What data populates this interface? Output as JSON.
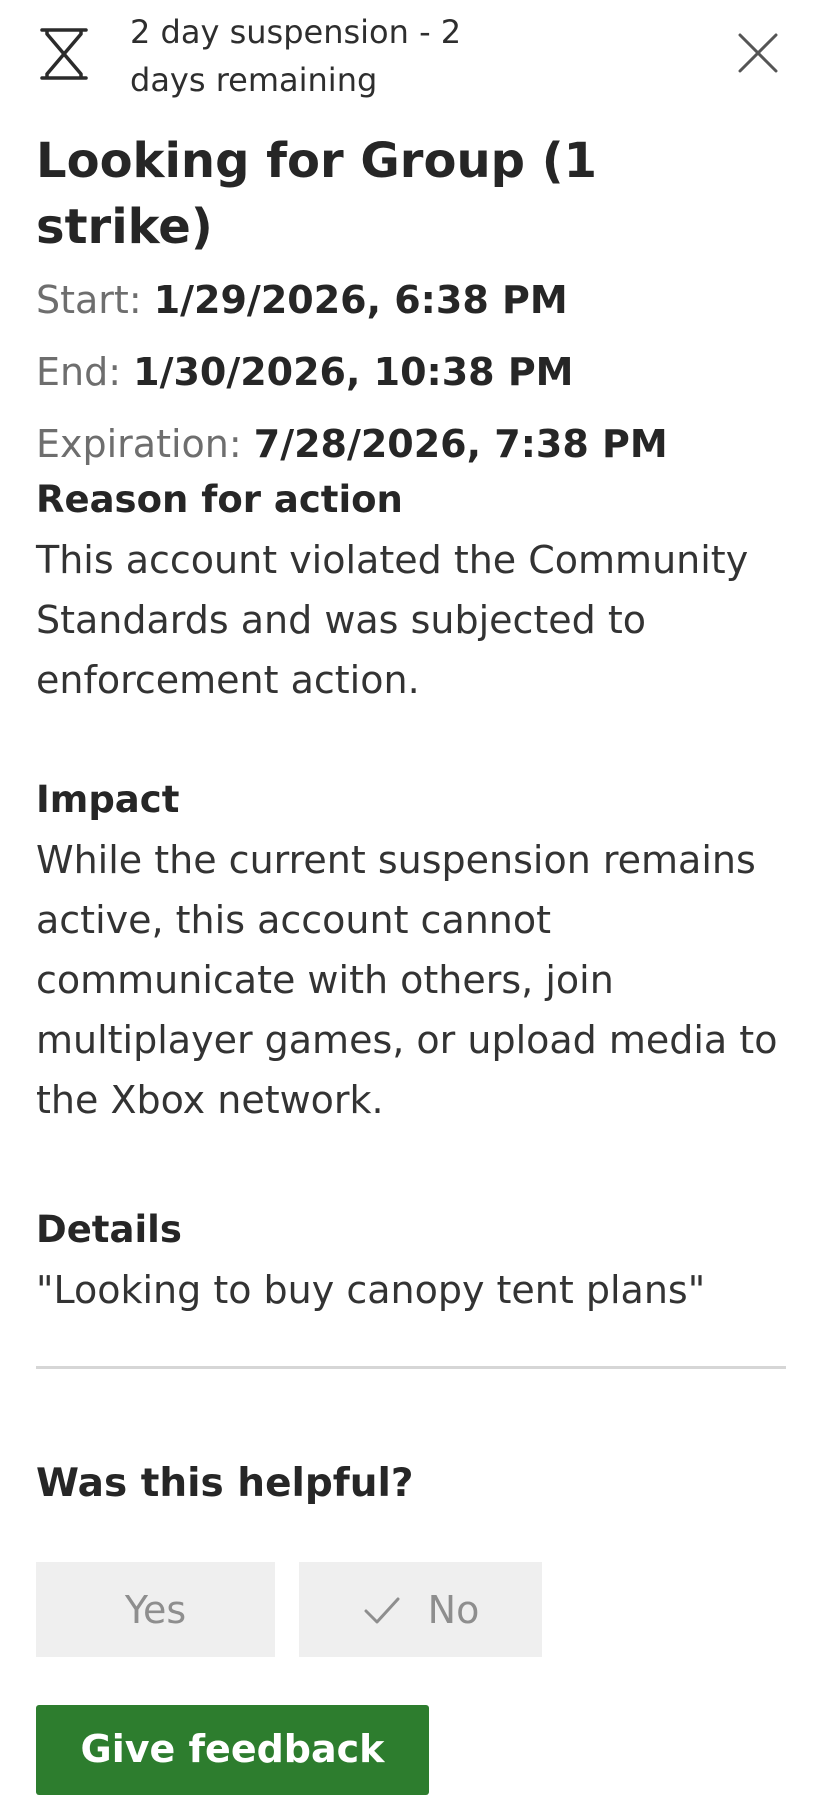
{
  "header": {
    "status_line_1": "2 day suspension - 2",
    "status_line_2": "days remaining",
    "status_icon": "hourglass-icon",
    "close_icon": "close-icon"
  },
  "enforcement": {
    "title": "Looking for Group (1 strike)",
    "start_label": "Start:",
    "start_value": "1/29/2026, 6:38 PM",
    "end_label": "End:",
    "end_value": "1/30/2026, 10:38 PM",
    "expiration_label": "Expiration:",
    "expiration_value": "7/28/2026, 7:38 PM"
  },
  "reason": {
    "heading": "Reason for action",
    "body": "This account violated the Community Standards and was subjected to enforcement action."
  },
  "impact": {
    "heading": "Impact",
    "body": "While the current suspension remains active, this account cannot communicate with others, join multiplayer games, or upload media to the Xbox network."
  },
  "details": {
    "heading": "Details",
    "body": "\"Looking to buy canopy tent plans\""
  },
  "feedback": {
    "question": "Was this helpful?",
    "yes_label": "Yes",
    "no_label": "No",
    "no_selected_icon": "check-icon",
    "give_feedback_label": "Give feedback",
    "accent_color": "#2d7d2e"
  }
}
